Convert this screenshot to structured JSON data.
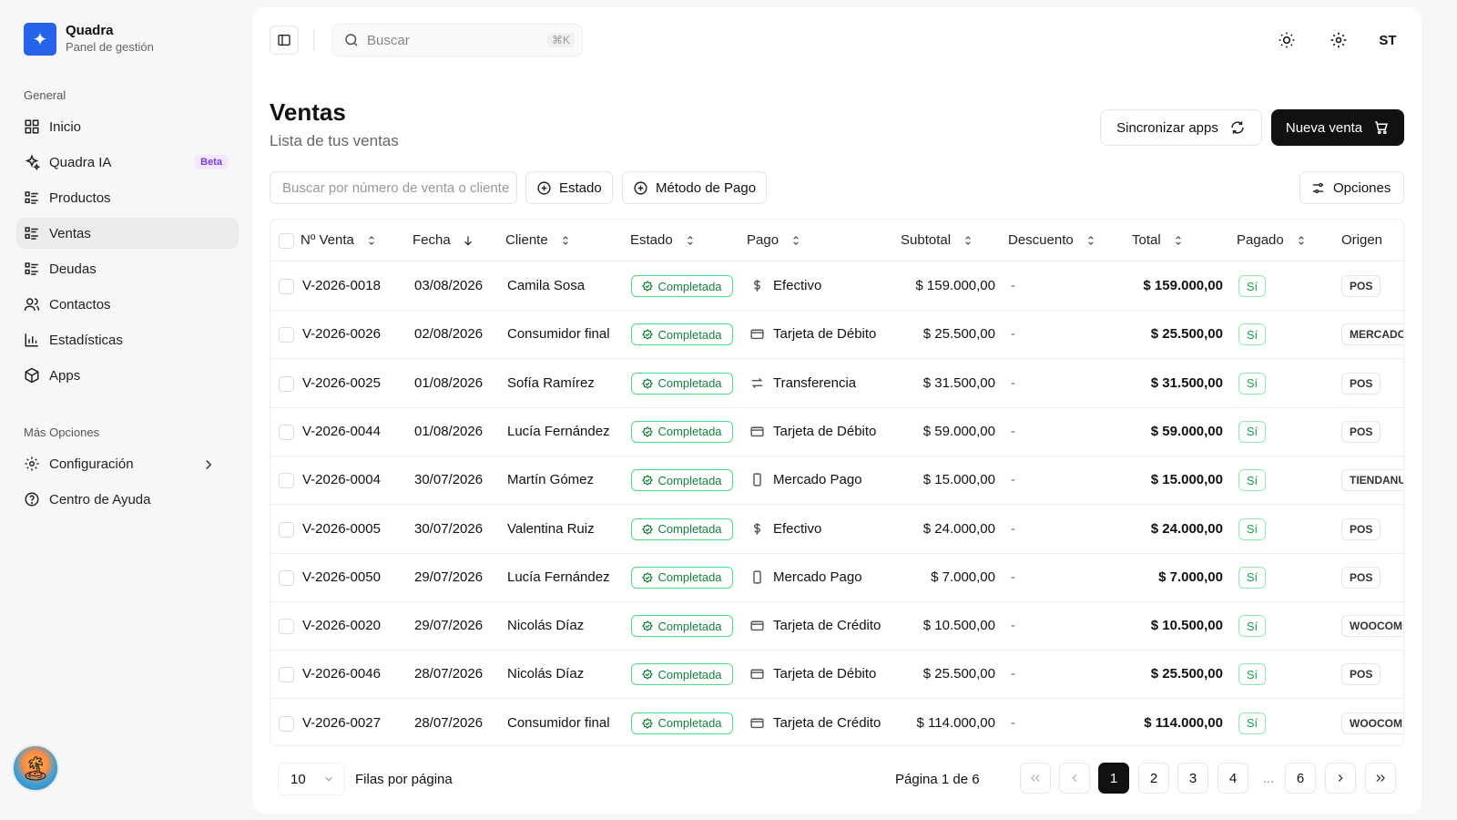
{
  "brand": {
    "name": "Quadra",
    "subtitle": "Panel de gestión",
    "logo_icon": "sparkle-icon",
    "accent": "#2563eb"
  },
  "sidebar": {
    "section_general": "General",
    "items": [
      {
        "label": "Inicio",
        "icon": "grid-icon"
      },
      {
        "label": "Quadra IA",
        "icon": "sparkles-icon",
        "badge": "Beta"
      },
      {
        "label": "Productos",
        "icon": "list-icon"
      },
      {
        "label": "Ventas",
        "icon": "list-icon",
        "active": true
      },
      {
        "label": "Deudas",
        "icon": "list-icon"
      },
      {
        "label": "Contactos",
        "icon": "users-icon"
      },
      {
        "label": "Estadísticas",
        "icon": "bar-chart-icon"
      },
      {
        "label": "Apps",
        "icon": "box-icon"
      }
    ],
    "section_more": "Más Opciones",
    "more_items": [
      {
        "label": "Configuración",
        "icon": "gear-icon"
      },
      {
        "label": "Centro de Ayuda",
        "icon": "help-icon"
      }
    ]
  },
  "topbar": {
    "search_placeholder": "Buscar",
    "search_shortcut": "⌘K",
    "avatar": "ST"
  },
  "page": {
    "title": "Ventas",
    "subtitle": "Lista de tus ventas"
  },
  "actions": {
    "sync_label": "Sincronizar apps",
    "new_sale_label": "Nueva venta",
    "options_label": "Opciones"
  },
  "filters": {
    "search_placeholder": "Buscar por número de venta o cliente",
    "estado_label": "Estado",
    "metodo_label": "Método de Pago"
  },
  "table": {
    "columns": [
      "Nº Venta",
      "Fecha",
      "Cliente",
      "Estado",
      "Pago",
      "Subtotal",
      "Descuento",
      "Total",
      "Pagado",
      "Origen"
    ],
    "rows": [
      {
        "id": "V-2026-0018",
        "fecha": "03/08/2026",
        "cliente": "Camila Sosa",
        "estado": "Completada",
        "pago": "Efectivo",
        "pago_icon": "dollar-icon",
        "subtotal": "$ 159.000,00",
        "descuento": "-",
        "total": "$ 159.000,00",
        "pagado": "Sí",
        "origen": "POS"
      },
      {
        "id": "V-2026-0026",
        "fecha": "02/08/2026",
        "cliente": "Consumidor final",
        "estado": "Completada",
        "pago": "Tarjeta de Débito",
        "pago_icon": "card-icon",
        "subtotal": "$ 25.500,00",
        "descuento": "-",
        "total": "$ 25.500,00",
        "pagado": "Sí",
        "origen": "MERCADO"
      },
      {
        "id": "V-2026-0025",
        "fecha": "01/08/2026",
        "cliente": "Sofía Ramírez",
        "estado": "Completada",
        "pago": "Transferencia",
        "pago_icon": "transfer-icon",
        "subtotal": "$ 31.500,00",
        "descuento": "-",
        "total": "$ 31.500,00",
        "pagado": "Sí",
        "origen": "POS"
      },
      {
        "id": "V-2026-0044",
        "fecha": "01/08/2026",
        "cliente": "Lucía Fernández",
        "estado": "Completada",
        "pago": "Tarjeta de Débito",
        "pago_icon": "card-icon",
        "subtotal": "$ 59.000,00",
        "descuento": "-",
        "total": "$ 59.000,00",
        "pagado": "Sí",
        "origen": "POS"
      },
      {
        "id": "V-2026-0004",
        "fecha": "30/07/2026",
        "cliente": "Martín Gómez",
        "estado": "Completada",
        "pago": "Mercado Pago",
        "pago_icon": "phone-icon",
        "subtotal": "$ 15.000,00",
        "descuento": "-",
        "total": "$ 15.000,00",
        "pagado": "Sí",
        "origen": "TIENDANU"
      },
      {
        "id": "V-2026-0005",
        "fecha": "30/07/2026",
        "cliente": "Valentina Ruiz",
        "estado": "Completada",
        "pago": "Efectivo",
        "pago_icon": "dollar-icon",
        "subtotal": "$ 24.000,00",
        "descuento": "-",
        "total": "$ 24.000,00",
        "pagado": "Sí",
        "origen": "POS"
      },
      {
        "id": "V-2026-0050",
        "fecha": "29/07/2026",
        "cliente": "Lucía Fernández",
        "estado": "Completada",
        "pago": "Mercado Pago",
        "pago_icon": "phone-icon",
        "subtotal": "$ 7.000,00",
        "descuento": "-",
        "total": "$ 7.000,00",
        "pagado": "Sí",
        "origen": "POS"
      },
      {
        "id": "V-2026-0020",
        "fecha": "29/07/2026",
        "cliente": "Nicolás Díaz",
        "estado": "Completada",
        "pago": "Tarjeta de Crédito",
        "pago_icon": "card-icon",
        "subtotal": "$ 10.500,00",
        "descuento": "-",
        "total": "$ 10.500,00",
        "pagado": "Sí",
        "origen": "WOOCOM"
      },
      {
        "id": "V-2026-0046",
        "fecha": "28/07/2026",
        "cliente": "Nicolás Díaz",
        "estado": "Completada",
        "pago": "Tarjeta de Débito",
        "pago_icon": "card-icon",
        "subtotal": "$ 25.500,00",
        "descuento": "-",
        "total": "$ 25.500,00",
        "pagado": "Sí",
        "origen": "POS"
      },
      {
        "id": "V-2026-0027",
        "fecha": "28/07/2026",
        "cliente": "Consumidor final",
        "estado": "Completada",
        "pago": "Tarjeta de Crédito",
        "pago_icon": "card-icon",
        "subtotal": "$ 114.000,00",
        "descuento": "-",
        "total": "$ 114.000,00",
        "pagado": "Sí",
        "origen": "WOOCOM"
      }
    ]
  },
  "pagination": {
    "rows_per_page": "10",
    "rows_label": "Filas por página",
    "page_info": "Página 1 de 6",
    "pages": [
      "1",
      "2",
      "3",
      "4",
      "...",
      "6"
    ],
    "current": "1"
  }
}
